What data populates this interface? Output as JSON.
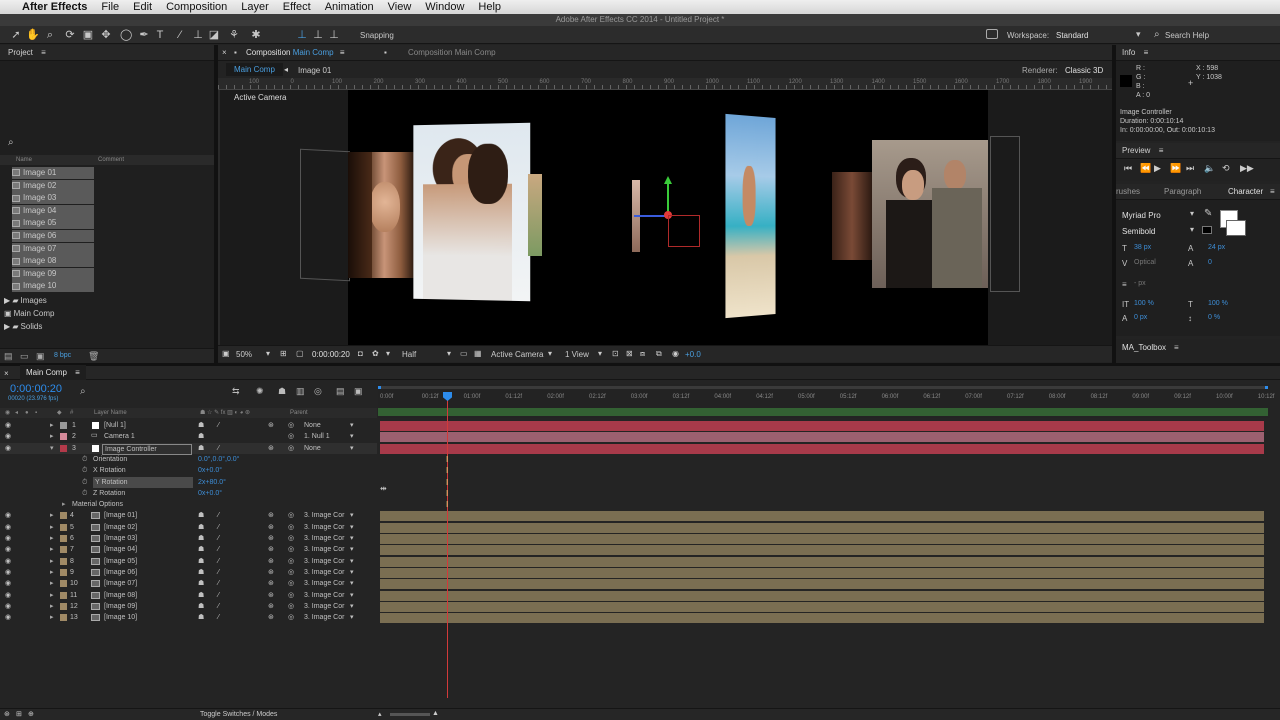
{
  "menubar": {
    "apple": "",
    "app": "After Effects",
    "items": [
      "File",
      "Edit",
      "Composition",
      "Layer",
      "Effect",
      "Animation",
      "View",
      "Window",
      "Help"
    ]
  },
  "titlebar": "Adobe After Effects CC 2014 - Untitled Project *",
  "toolbar": {
    "snapping": "Snapping",
    "workspace_label": "Workspace:",
    "workspace_value": "Standard",
    "search": "Search Help"
  },
  "project": {
    "title": "Project",
    "col_name": "Name",
    "col_comment": "Comment",
    "items": [
      "Image 01",
      "Image 02",
      "Image 03",
      "Image 04",
      "Image 05",
      "Image 06",
      "Image 07",
      "Image 08",
      "Image 09",
      "Image 10"
    ],
    "folders": [
      "Images",
      "Main Comp",
      "Solids"
    ],
    "bpc": "8 bpc"
  },
  "composition": {
    "tab": "Composition",
    "tab_comp": "Main Comp",
    "tab2": "Composition Main Comp",
    "crumb1": "Main Comp",
    "crumb2": "Image 01",
    "renderer_label": "Renderer:",
    "renderer": "Classic 3D",
    "camera": "Active Camera",
    "ruler": [
      "100",
      "0",
      "100",
      "200",
      "300",
      "400",
      "500",
      "600",
      "700",
      "800",
      "900",
      "1000",
      "1100",
      "1200",
      "1300",
      "1400",
      "1500",
      "1600",
      "1700",
      "1800",
      "1900",
      "2000"
    ]
  },
  "viewer_bar": {
    "zoom": "50%",
    "time": "0:00:00:20",
    "quality": "Half",
    "camera": "Active Camera",
    "views": "1 View",
    "exposure": "+0.0"
  },
  "info": {
    "title": "Info",
    "r": "R :",
    "g": "G :",
    "b": "B :",
    "a": "A : 0",
    "x": "X : 598",
    "y": "Y : 1038",
    "name": "Image Controller",
    "duration": "Duration: 0:00:10:14",
    "inout": "In: 0:00:00:00, Out: 0:00:10:13"
  },
  "preview": {
    "title": "Preview"
  },
  "character": {
    "tabs": [
      "rushes",
      "Paragraph",
      "Character"
    ],
    "font": "Myriad Pro",
    "style": "Semibold",
    "size": "38 px",
    "leading": "24 px",
    "kerning": "Optical",
    "tracking": "0",
    "stroke": "- px",
    "vscale": "100 %",
    "hscale": "100 %",
    "baseline": "0 px",
    "tsume": "0 %"
  },
  "toolbox": {
    "title": "MA_Toolbox"
  },
  "timeline": {
    "tab": "Main Comp",
    "time": "0:00:00:20",
    "fps": "00020 (23.976 fps)",
    "col_num": "#",
    "col_layer": "Layer Name",
    "col_parent": "Parent",
    "ticks": [
      "0:00f",
      "00:12f",
      "01:00f",
      "01:12f",
      "02:00f",
      "02:12f",
      "03:00f",
      "03:12f",
      "04:00f",
      "04:12f",
      "05:00f",
      "05:12f",
      "06:00f",
      "06:12f",
      "07:00f",
      "07:12f",
      "08:00f",
      "08:12f",
      "09:00f",
      "09:12f",
      "10:00f",
      "10:12f"
    ],
    "layers": [
      {
        "n": "1",
        "name": "[Null 1]",
        "parent": "None"
      },
      {
        "n": "2",
        "name": "Camera 1",
        "parent": "1. Null 1"
      },
      {
        "n": "3",
        "name": "Image Controller",
        "parent": "None"
      }
    ],
    "props": [
      {
        "name": "Orientation",
        "value": "0.0°,0.0°,0.0°"
      },
      {
        "name": "X Rotation",
        "value": "0x+0.0°"
      },
      {
        "name": "Y Rotation",
        "value": "2x+80.0°"
      },
      {
        "name": "Z Rotation",
        "value": "0x+0.0°"
      },
      {
        "name": "Material Options",
        "value": ""
      }
    ],
    "images": [
      {
        "n": "4",
        "name": "[Image 01]"
      },
      {
        "n": "5",
        "name": "[Image 02]"
      },
      {
        "n": "6",
        "name": "[Image 03]"
      },
      {
        "n": "7",
        "name": "[Image 04]"
      },
      {
        "n": "8",
        "name": "[Image 05]"
      },
      {
        "n": "9",
        "name": "[Image 06]"
      },
      {
        "n": "10",
        "name": "[Image 07]"
      },
      {
        "n": "11",
        "name": "[Image 08]"
      },
      {
        "n": "12",
        "name": "[Image 09]"
      },
      {
        "n": "13",
        "name": "[Image 10]"
      }
    ],
    "image_parent": "3. Image Cor",
    "toggle": "Toggle Switches / Modes"
  },
  "colors": {
    "accent": "#2d8ceb",
    "null_bar": "#a83a4a",
    "camera_bar": "#9c6070",
    "image_bar": "#7a6e52",
    "playhead": "#d23a3a"
  }
}
